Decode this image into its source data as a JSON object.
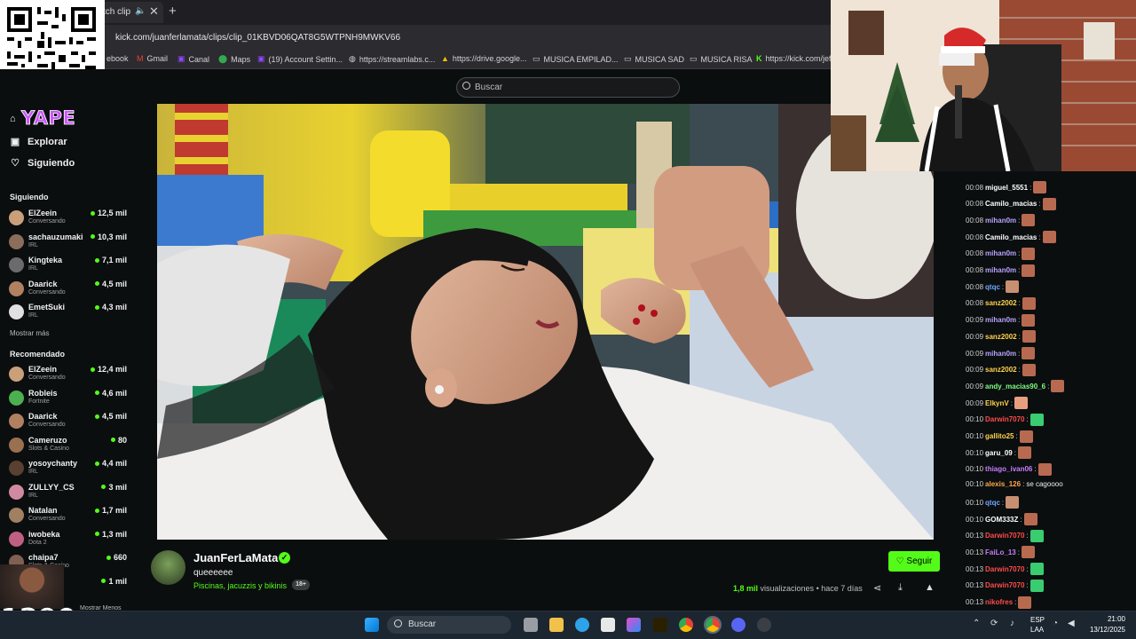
{
  "browser": {
    "tab_title": "tch clip",
    "url": "kick.com/juanferlamata/clips/clip_01KBVD06QAT8G5WTPNH9MWKV66",
    "bookmarks": [
      "ebook",
      "Gmail",
      "Canal",
      "Maps",
      "(19) Account Settin...",
      "https://streamlabs.c...",
      "https://drive.google...",
      "MUSICA EMPILAD...",
      "MUSICA SAD",
      "MUSICA RISA",
      "https://kick.com/jef"
    ]
  },
  "header": {
    "search_placeholder": "Buscar"
  },
  "overlay": {
    "yape": "YAPE"
  },
  "sidebar": {
    "nav": [
      {
        "label": "Explorar",
        "icon": "compass-icon"
      },
      {
        "label": "Siguiendo",
        "icon": "heart-icon"
      }
    ],
    "following_title": "Siguiendo",
    "following": [
      {
        "name": "ElZeein",
        "category": "Conversando",
        "viewers": "12,5 mil",
        "color": "#c9a07a"
      },
      {
        "name": "sachauzumaki",
        "category": "IRL",
        "viewers": "10,3 mil",
        "color": "#8a6d5a"
      },
      {
        "name": "Kingteka",
        "category": "IRL",
        "viewers": "7,1 mil",
        "color": "#6b6b6b"
      },
      {
        "name": "Daarick",
        "category": "Conversando",
        "viewers": "4,5 mil",
        "color": "#b08060"
      },
      {
        "name": "EmetSuki",
        "category": "IRL",
        "viewers": "4,3 mil",
        "color": "#e0e0e0"
      }
    ],
    "show_more": "Mostrar más",
    "recommended_title": "Recomendado",
    "recommended": [
      {
        "name": "ElZeein",
        "category": "Conversando",
        "viewers": "12,4 mil",
        "color": "#c9a07a"
      },
      {
        "name": "Robleis",
        "category": "Fortnite",
        "viewers": "4,6 mil",
        "color": "#4caf50"
      },
      {
        "name": "Daarick",
        "category": "Conversando",
        "viewers": "4,5 mil",
        "color": "#b08060"
      },
      {
        "name": "Cameruzo",
        "category": "Slots & Casino",
        "viewers": "80",
        "color": "#9a7050"
      },
      {
        "name": "yosoychanty",
        "category": "IRL",
        "viewers": "4,4 mil",
        "color": "#5a4030"
      },
      {
        "name": "ZULLYY_CS",
        "category": "IRL",
        "viewers": "3 mil",
        "color": "#d08aa0"
      },
      {
        "name": "Natalan",
        "category": "Conversando",
        "viewers": "1,7 mil",
        "color": "#a08060"
      },
      {
        "name": "iwobeka",
        "category": "Dota 2",
        "viewers": "1,3 mil",
        "color": "#c06080"
      },
      {
        "name": "chaipa7",
        "category": "Slots & Casino",
        "viewers": "660",
        "color": "#806050"
      },
      {
        "name": "",
        "category": "",
        "viewers": "1 mil",
        "color": "#705040"
      }
    ],
    "show_less": "Mostrar Menos"
  },
  "clip": {
    "streamer": "JuanFerLaMata",
    "title": "queeeeee",
    "category": "Piscinas, jacuzzis y bikinis",
    "age_badge": "18+",
    "follow_label": "Seguir",
    "views_count": "1,8 mil",
    "views_label": "visualizaciones",
    "age": "• hace 7 días"
  },
  "chat": [
    {
      "time": "00:08",
      "user": "miguel_5551",
      "color": "#ffffff",
      "emote": "#b86a50"
    },
    {
      "time": "00:08",
      "user": "Camilo_macias",
      "color": "#ffffff",
      "emote": "#b86a50"
    },
    {
      "time": "00:08",
      "user": "mihan0m",
      "color": "#b9a4ff",
      "emote": "#b86a50"
    },
    {
      "time": "00:08",
      "user": "Camilo_macias",
      "color": "#ffffff",
      "emote": "#b86a50"
    },
    {
      "time": "00:08",
      "user": "mihan0m",
      "color": "#b9a4ff",
      "emote": "#b86a50"
    },
    {
      "time": "00:08",
      "user": "mihan0m",
      "color": "#b9a4ff",
      "emote": "#b86a50"
    },
    {
      "time": "00:08",
      "user": "qtqc",
      "color": "#6fa8ff",
      "emote": "#c89070"
    },
    {
      "time": "00:08",
      "user": "sanz2002",
      "color": "#ffd34d",
      "emote": "#b86a50"
    },
    {
      "time": "00:09",
      "user": "mihan0m",
      "color": "#b9a4ff",
      "emote": "#b86a50"
    },
    {
      "time": "00:09",
      "user": "sanz2002",
      "color": "#ffd34d",
      "emote": "#b86a50"
    },
    {
      "time": "00:09",
      "user": "mihan0m",
      "color": "#b9a4ff",
      "emote": "#b86a50"
    },
    {
      "time": "00:09",
      "user": "sanz2002",
      "color": "#ffd34d",
      "emote": "#b86a50"
    },
    {
      "time": "00:09",
      "user": "andy_macias90_6",
      "color": "#7dff7d",
      "emote": "#b86a50"
    },
    {
      "time": "00:09",
      "user": "ElkynV",
      "color": "#ffd34d",
      "emote": "#e6a080"
    },
    {
      "time": "00:10",
      "user": "Darwin7070",
      "color": "#ff4b4b",
      "emote": "#3acc70"
    },
    {
      "time": "00:10",
      "user": "gallito25",
      "color": "#ffd34d",
      "emote": "#b86a50"
    },
    {
      "time": "00:10",
      "user": "garu_09",
      "color": "#ffffff",
      "emote": "#b86a50"
    },
    {
      "time": "00:10",
      "user": "thiago_ivan06",
      "color": "#c77dff",
      "emote": "#b86a50"
    },
    {
      "time": "00:10",
      "user": "alexis_126",
      "color": "#ffa64d",
      "text": "se cagoooo"
    },
    {
      "time": "00:10",
      "user": "qtqc",
      "color": "#6fa8ff",
      "emote": "#c89070"
    },
    {
      "time": "00:10",
      "user": "GOM333Z",
      "color": "#ffffff",
      "emote": "#b86a50"
    },
    {
      "time": "00:13",
      "user": "Darwin7070",
      "color": "#ff4b4b",
      "emote": "#3acc70"
    },
    {
      "time": "00:13",
      "user": "FaiLo_13",
      "color": "#c77dff",
      "emote": "#b86a50"
    },
    {
      "time": "00:13",
      "user": "Darwin7070",
      "color": "#ff4b4b",
      "emote": "#3acc70"
    },
    {
      "time": "00:13",
      "user": "Darwin7070",
      "color": "#ff4b4b",
      "emote": "#3acc70"
    },
    {
      "time": "00:13",
      "user": "nikofres",
      "color": "#ff4b4b",
      "emote": "#b86a50"
    }
  ],
  "overlay_text": "1290",
  "taskbar": {
    "search": "Buscar",
    "lang_1": "ESP",
    "lang_2": "LAA",
    "time": "21:00",
    "date": "13/12/2025"
  },
  "colors": {
    "accent": "#53fc18",
    "background": "#0b0e0f"
  }
}
